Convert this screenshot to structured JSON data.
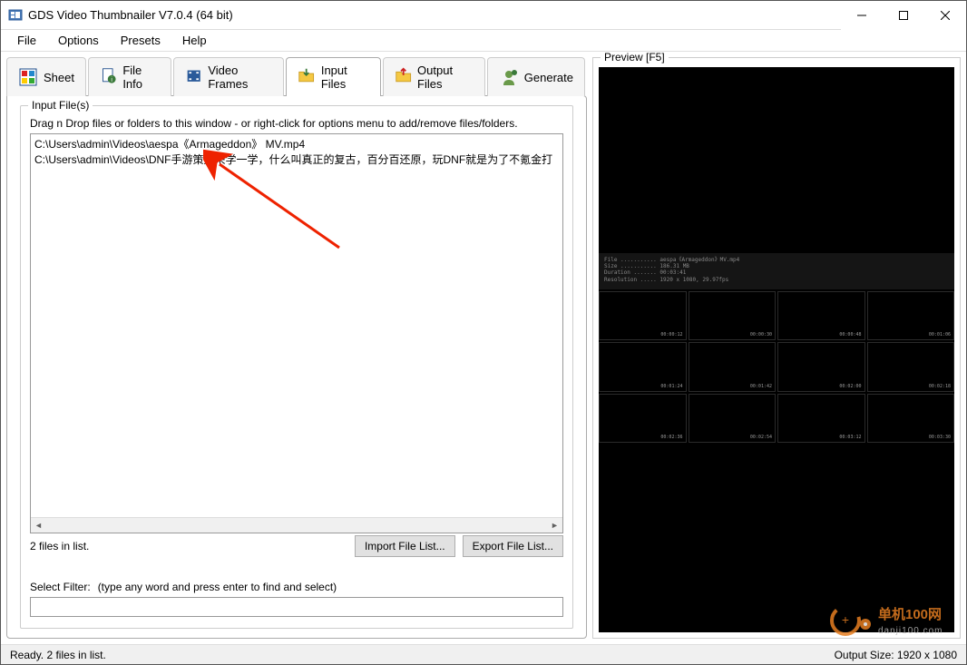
{
  "window": {
    "title": "GDS Video Thumbnailer V7.0.4 (64 bit)"
  },
  "menu": {
    "file": "File",
    "options": "Options",
    "presets": "Presets",
    "help": "Help"
  },
  "tabs": {
    "sheet": "Sheet",
    "file_info": "File Info",
    "video_frames": "Video Frames",
    "input_files": "Input Files",
    "output_files": "Output Files",
    "generate": "Generate"
  },
  "input_files": {
    "legend": "Input File(s)",
    "hint": "Drag n Drop files or folders to this window - or right-click for options menu to add/remove files/folders.",
    "files": [
      "C:\\Users\\admin\\Videos\\aespa《Armageddon》 MV.mp4",
      "C:\\Users\\admin\\Videos\\DNF手游策划来学一学，什么叫真正的复古，百分百还原，玩DNF就是为了不氪金打"
    ],
    "count_text": "2 files in list.",
    "import_btn": "Import File List...",
    "export_btn": "Export File List..."
  },
  "filter": {
    "label": "Select Filter:",
    "hint": "(type any word and press enter to find and select)",
    "value": ""
  },
  "preview": {
    "legend": "Preview   [F5]",
    "header_lines": [
      "File ........... aespa《Armageddon》MV.mp4",
      "Size ........... 186.31 MB",
      "Duration ....... 00:03:41",
      "Resolution ..... 1920 x 1080, 29.97fps"
    ],
    "timestamps": [
      "00:00:12",
      "00:00:30",
      "00:00:48",
      "00:01:06",
      "00:01:24",
      "00:01:42",
      "00:02:00",
      "00:02:18",
      "00:02:36",
      "00:02:54",
      "00:03:12",
      "00:03:30"
    ]
  },
  "statusbar": {
    "left": "Ready. 2 files in list.",
    "right": "Output Size: 1920 x 1080"
  },
  "watermark": {
    "text": "单机100网"
  }
}
